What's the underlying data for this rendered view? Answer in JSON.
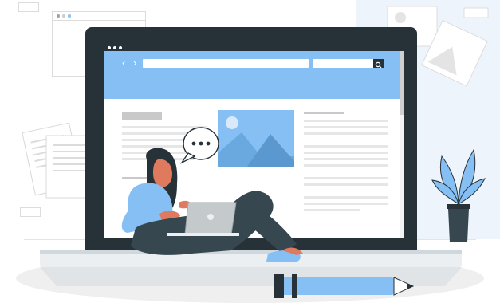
{
  "colors": {
    "accent": "#85bff3",
    "dark": "#263238",
    "skin": "#e07a5f",
    "pants": "#37474f"
  },
  "icons": {
    "back": "‹",
    "forward": "›",
    "search": "search-icon"
  }
}
